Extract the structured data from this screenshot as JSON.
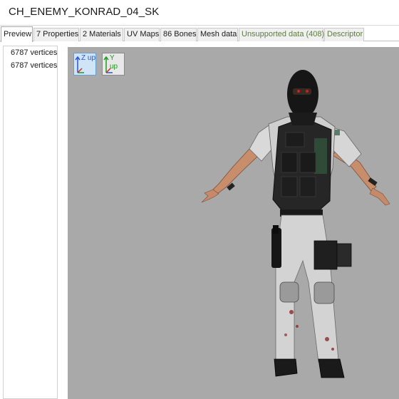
{
  "window": {
    "title": "CH_ENEMY_KONRAD_04_SK"
  },
  "tabs": [
    {
      "label": "Preview"
    },
    {
      "label": "7 Properties"
    },
    {
      "label": "2 Materials"
    },
    {
      "label": "UV Maps"
    },
    {
      "label": "86 Bones"
    },
    {
      "label": "Mesh data"
    },
    {
      "label": "Unsupported data (408)"
    },
    {
      "label": "Descriptor"
    }
  ],
  "lod_list": [
    {
      "label": "6787 vertices"
    },
    {
      "label": "6787 vertices"
    }
  ],
  "viewport": {
    "background": "#a9a9a9",
    "up_axis_buttons": [
      {
        "label": "Z up",
        "active": true
      },
      {
        "label": "Y up",
        "active": false
      }
    ]
  },
  "colors": {
    "tab_muted_text": "#5a7d3a",
    "axis_blue": "#2a55d4",
    "axis_green": "#1c9c1c",
    "axis_red": "#d22a2a",
    "axis_active_bg": "#cfe4f7"
  }
}
